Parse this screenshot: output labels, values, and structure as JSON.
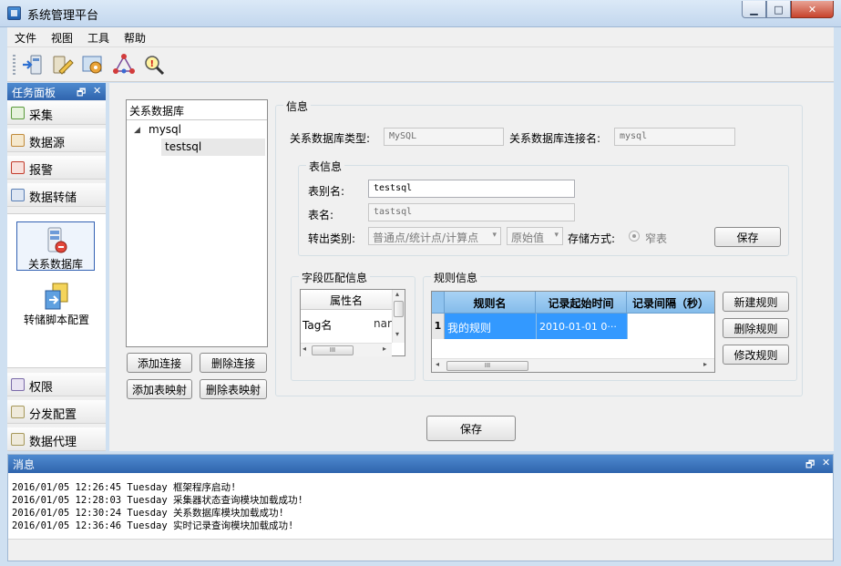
{
  "window": {
    "title": "系统管理平台",
    "controls": {
      "minimize": "▁",
      "maximize": "□",
      "close": "✕"
    }
  },
  "menu": [
    "文件",
    "视图",
    "工具",
    "帮助"
  ],
  "toolbar_icons": [
    "connect-icon",
    "edit-db-icon",
    "config-gear-icon",
    "network-icon",
    "search-warning-icon"
  ],
  "task_panel": {
    "title": "任务面板",
    "pin": "🗗",
    "close": "✕",
    "items_top": [
      {
        "label": "采集",
        "icon": "collect-icon",
        "color": "#5a9a3c"
      },
      {
        "label": "数据源",
        "icon": "datasource-icon",
        "color": "#c08a3a"
      },
      {
        "label": "报警",
        "icon": "alarm-icon",
        "color": "#c23b2b"
      },
      {
        "label": "数据转储",
        "icon": "transfer-icon",
        "color": "#5a7fb5"
      }
    ],
    "sub_items": [
      {
        "label": "关系数据库",
        "icon": "relational-db-icon"
      },
      {
        "label": "转储脚本配置",
        "icon": "script-config-icon"
      }
    ],
    "items_bottom": [
      {
        "label": "权限",
        "icon": "permission-icon",
        "color": "#7a6aa8"
      },
      {
        "label": "分发配置",
        "icon": "distribution-icon",
        "color": "#a6985a"
      },
      {
        "label": "数据代理",
        "icon": "proxy-icon",
        "color": "#a6985a"
      }
    ]
  },
  "tree": {
    "header": "关系数据库",
    "toggle": "◢",
    "root": "mysql",
    "child": "testsql"
  },
  "left_buttons": {
    "add_connection": "添加连接",
    "delete_connection": "删除连接",
    "add_table_mapping": "添加表映射",
    "delete_table_mapping": "删除表映射"
  },
  "info": {
    "group_title": "信息",
    "db_type_label": "关系数据库类型:",
    "db_type_value": "MySQL",
    "conn_name_label": "关系数据库连接名:",
    "conn_name_value": "mysql",
    "table_info": {
      "group_title": "表信息",
      "alias_label": "表别名:",
      "alias_value": "testsql",
      "name_label": "表名:",
      "name_value": "tastsql",
      "export_type_label": "转出类别:",
      "export_type_value": "普通点/统计点/计算点",
      "mode_value": "原始值",
      "storage_label": "存储方式:",
      "storage_option": "窄表",
      "save": "保存"
    },
    "field_match": {
      "group_title": "字段匹配信息",
      "columns": [
        "属性名"
      ],
      "row": [
        "Tag名",
        "nar"
      ]
    },
    "rule_info": {
      "group_title": "规则信息",
      "columns": [
        "规则名",
        "记录起始时间",
        "记录间隔（秒）"
      ],
      "row": {
        "index": "1",
        "name": "我的规则",
        "start": "2010-01-01 0···",
        "interval": ""
      },
      "new_rule": "新建规则",
      "delete_rule": "删除规则",
      "edit_rule": "修改规则"
    }
  },
  "main_save": "保存",
  "scroll": {
    "left": "◂",
    "right": "▸",
    "up": "▴",
    "down": "▾",
    "thumb": "III"
  },
  "messages": {
    "title": "消息",
    "pin": "🗗",
    "close": "✕",
    "lines": [
      "2016/01/05 12:26:45 Tuesday 框架程序启动!",
      "2016/01/05 12:28:03 Tuesday 采集器状态查询模块加载成功!",
      "2016/01/05 12:30:24 Tuesday 关系数据库模块加载成功!",
      "2016/01/05 12:36:46 Tuesday 实时记录查询模块加载成功!"
    ]
  },
  "colors": {
    "accent_blue": "#2f64ad",
    "grid_header_blue": "#8fc3ef",
    "selected_row": "#3399ff"
  }
}
